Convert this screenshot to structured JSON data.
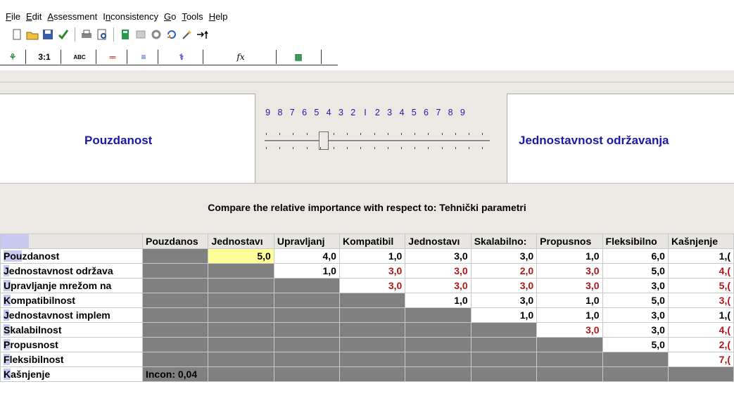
{
  "menu": [
    {
      "label": "File",
      "u": "F",
      "rest": "ile"
    },
    {
      "label": "Edit",
      "u": "E",
      "rest": "dit"
    },
    {
      "label": "Assessment",
      "u": "A",
      "rest": "ssessment"
    },
    {
      "label": "Inconsistency",
      "pre": "I",
      "u": "n",
      "rest": "consistency"
    },
    {
      "label": "Go",
      "u": "G",
      "rest": "o"
    },
    {
      "label": "Tools",
      "u": "T",
      "rest": "ools"
    },
    {
      "label": "Help",
      "u": "H",
      "rest": "elp"
    }
  ],
  "tabs": [
    {
      "label": "⚘",
      "icon": "tree-icon"
    },
    {
      "label": "3:1",
      "icon": "numeric-compare-icon"
    },
    {
      "label": "ABC",
      "icon": "verbal-compare-icon"
    },
    {
      "label": "═",
      "icon": "graphic-compare-icon"
    },
    {
      "label": "≡",
      "icon": "bars-icon"
    },
    {
      "label": "⚕",
      "icon": "questionnaire-icon"
    },
    {
      "label": "fx",
      "icon": "formula-icon"
    },
    {
      "label": "▦",
      "icon": "matrix-icon"
    }
  ],
  "comparison": {
    "left_criterion": "Pouzdanost",
    "right_criterion": "Jednostavnost održavanja",
    "scale": [
      "9",
      "8",
      "7",
      "6",
      "5",
      "4",
      "3",
      "2",
      "I",
      "2",
      "3",
      "4",
      "5",
      "6",
      "7",
      "8",
      "9"
    ],
    "slider_value": -5,
    "prompt": "Compare the relative importance with respect to: Tehnički parametri"
  },
  "matrix": {
    "columns": [
      "Pouzdanos",
      "Jednostavı",
      "Upravljanj",
      "Kompatibil",
      "Jednostavı",
      "Skalabilno:",
      "Propusnos",
      "Fleksibilno",
      "Kašnjenje"
    ],
    "rows": [
      {
        "hl": "Pou",
        "rest": "zdanost",
        "cells": [
          [
            "g",
            ""
          ],
          [
            "y",
            "5,0"
          ],
          [
            "v",
            "4,0"
          ],
          [
            "v",
            "1,0"
          ],
          [
            "v",
            "3,0"
          ],
          [
            "v",
            "3,0"
          ],
          [
            "v",
            "1,0"
          ],
          [
            "v",
            "6,0"
          ],
          [
            "v",
            "1,("
          ]
        ]
      },
      {
        "hl": "J",
        "rest": "ednostavnost održava",
        "cells": [
          [
            "g",
            ""
          ],
          [
            "g",
            ""
          ],
          [
            "v",
            "1,0"
          ],
          [
            "r",
            "3,0"
          ],
          [
            "r",
            "3,0"
          ],
          [
            "r",
            "2,0"
          ],
          [
            "r",
            "3,0"
          ],
          [
            "v",
            "5,0"
          ],
          [
            "r",
            "4,("
          ]
        ]
      },
      {
        "hl": "U",
        "rest": "pravljanje mrežom na",
        "cells": [
          [
            "g",
            ""
          ],
          [
            "g",
            ""
          ],
          [
            "g",
            ""
          ],
          [
            "r",
            "3,0"
          ],
          [
            "r",
            "3,0"
          ],
          [
            "r",
            "3,0"
          ],
          [
            "r",
            "3,0"
          ],
          [
            "v",
            "3,0"
          ],
          [
            "r",
            "5,("
          ]
        ]
      },
      {
        "hl": "K",
        "rest": "ompatibilnost",
        "cells": [
          [
            "g",
            ""
          ],
          [
            "g",
            ""
          ],
          [
            "g",
            ""
          ],
          [
            "g",
            ""
          ],
          [
            "v",
            "1,0"
          ],
          [
            "v",
            "3,0"
          ],
          [
            "v",
            "1,0"
          ],
          [
            "v",
            "5,0"
          ],
          [
            "r",
            "3,("
          ]
        ]
      },
      {
        "hl": "J",
        "rest": "ednostavnost implem",
        "cells": [
          [
            "g",
            ""
          ],
          [
            "g",
            ""
          ],
          [
            "g",
            ""
          ],
          [
            "g",
            ""
          ],
          [
            "g",
            ""
          ],
          [
            "v",
            "1,0"
          ],
          [
            "v",
            "1,0"
          ],
          [
            "v",
            "3,0"
          ],
          [
            "v",
            "1,("
          ]
        ]
      },
      {
        "hl": "S",
        "rest": "kalabilnost",
        "cells": [
          [
            "g",
            ""
          ],
          [
            "g",
            ""
          ],
          [
            "g",
            ""
          ],
          [
            "g",
            ""
          ],
          [
            "g",
            ""
          ],
          [
            "g",
            ""
          ],
          [
            "r",
            "3,0"
          ],
          [
            "v",
            "3,0"
          ],
          [
            "r",
            "4,("
          ]
        ]
      },
      {
        "hl": "P",
        "rest": "ropusnost",
        "cells": [
          [
            "g",
            ""
          ],
          [
            "g",
            ""
          ],
          [
            "g",
            ""
          ],
          [
            "g",
            ""
          ],
          [
            "g",
            ""
          ],
          [
            "g",
            ""
          ],
          [
            "g",
            ""
          ],
          [
            "v",
            "5,0"
          ],
          [
            "r",
            "2,("
          ]
        ]
      },
      {
        "hl": "F",
        "rest": "leksibilnost",
        "cells": [
          [
            "g",
            ""
          ],
          [
            "g",
            ""
          ],
          [
            "g",
            ""
          ],
          [
            "g",
            ""
          ],
          [
            "g",
            ""
          ],
          [
            "g",
            ""
          ],
          [
            "g",
            ""
          ],
          [
            "g",
            ""
          ],
          [
            "r",
            "7,("
          ]
        ]
      },
      {
        "hl": "K",
        "rest": "ašnjenje",
        "cells": [
          [
            "i",
            "Incon: 0,04"
          ],
          [
            "g",
            ""
          ],
          [
            "g",
            ""
          ],
          [
            "g",
            ""
          ],
          [
            "g",
            ""
          ],
          [
            "g",
            ""
          ],
          [
            "g",
            ""
          ],
          [
            "g",
            ""
          ],
          [
            "g",
            ""
          ]
        ]
      }
    ]
  }
}
